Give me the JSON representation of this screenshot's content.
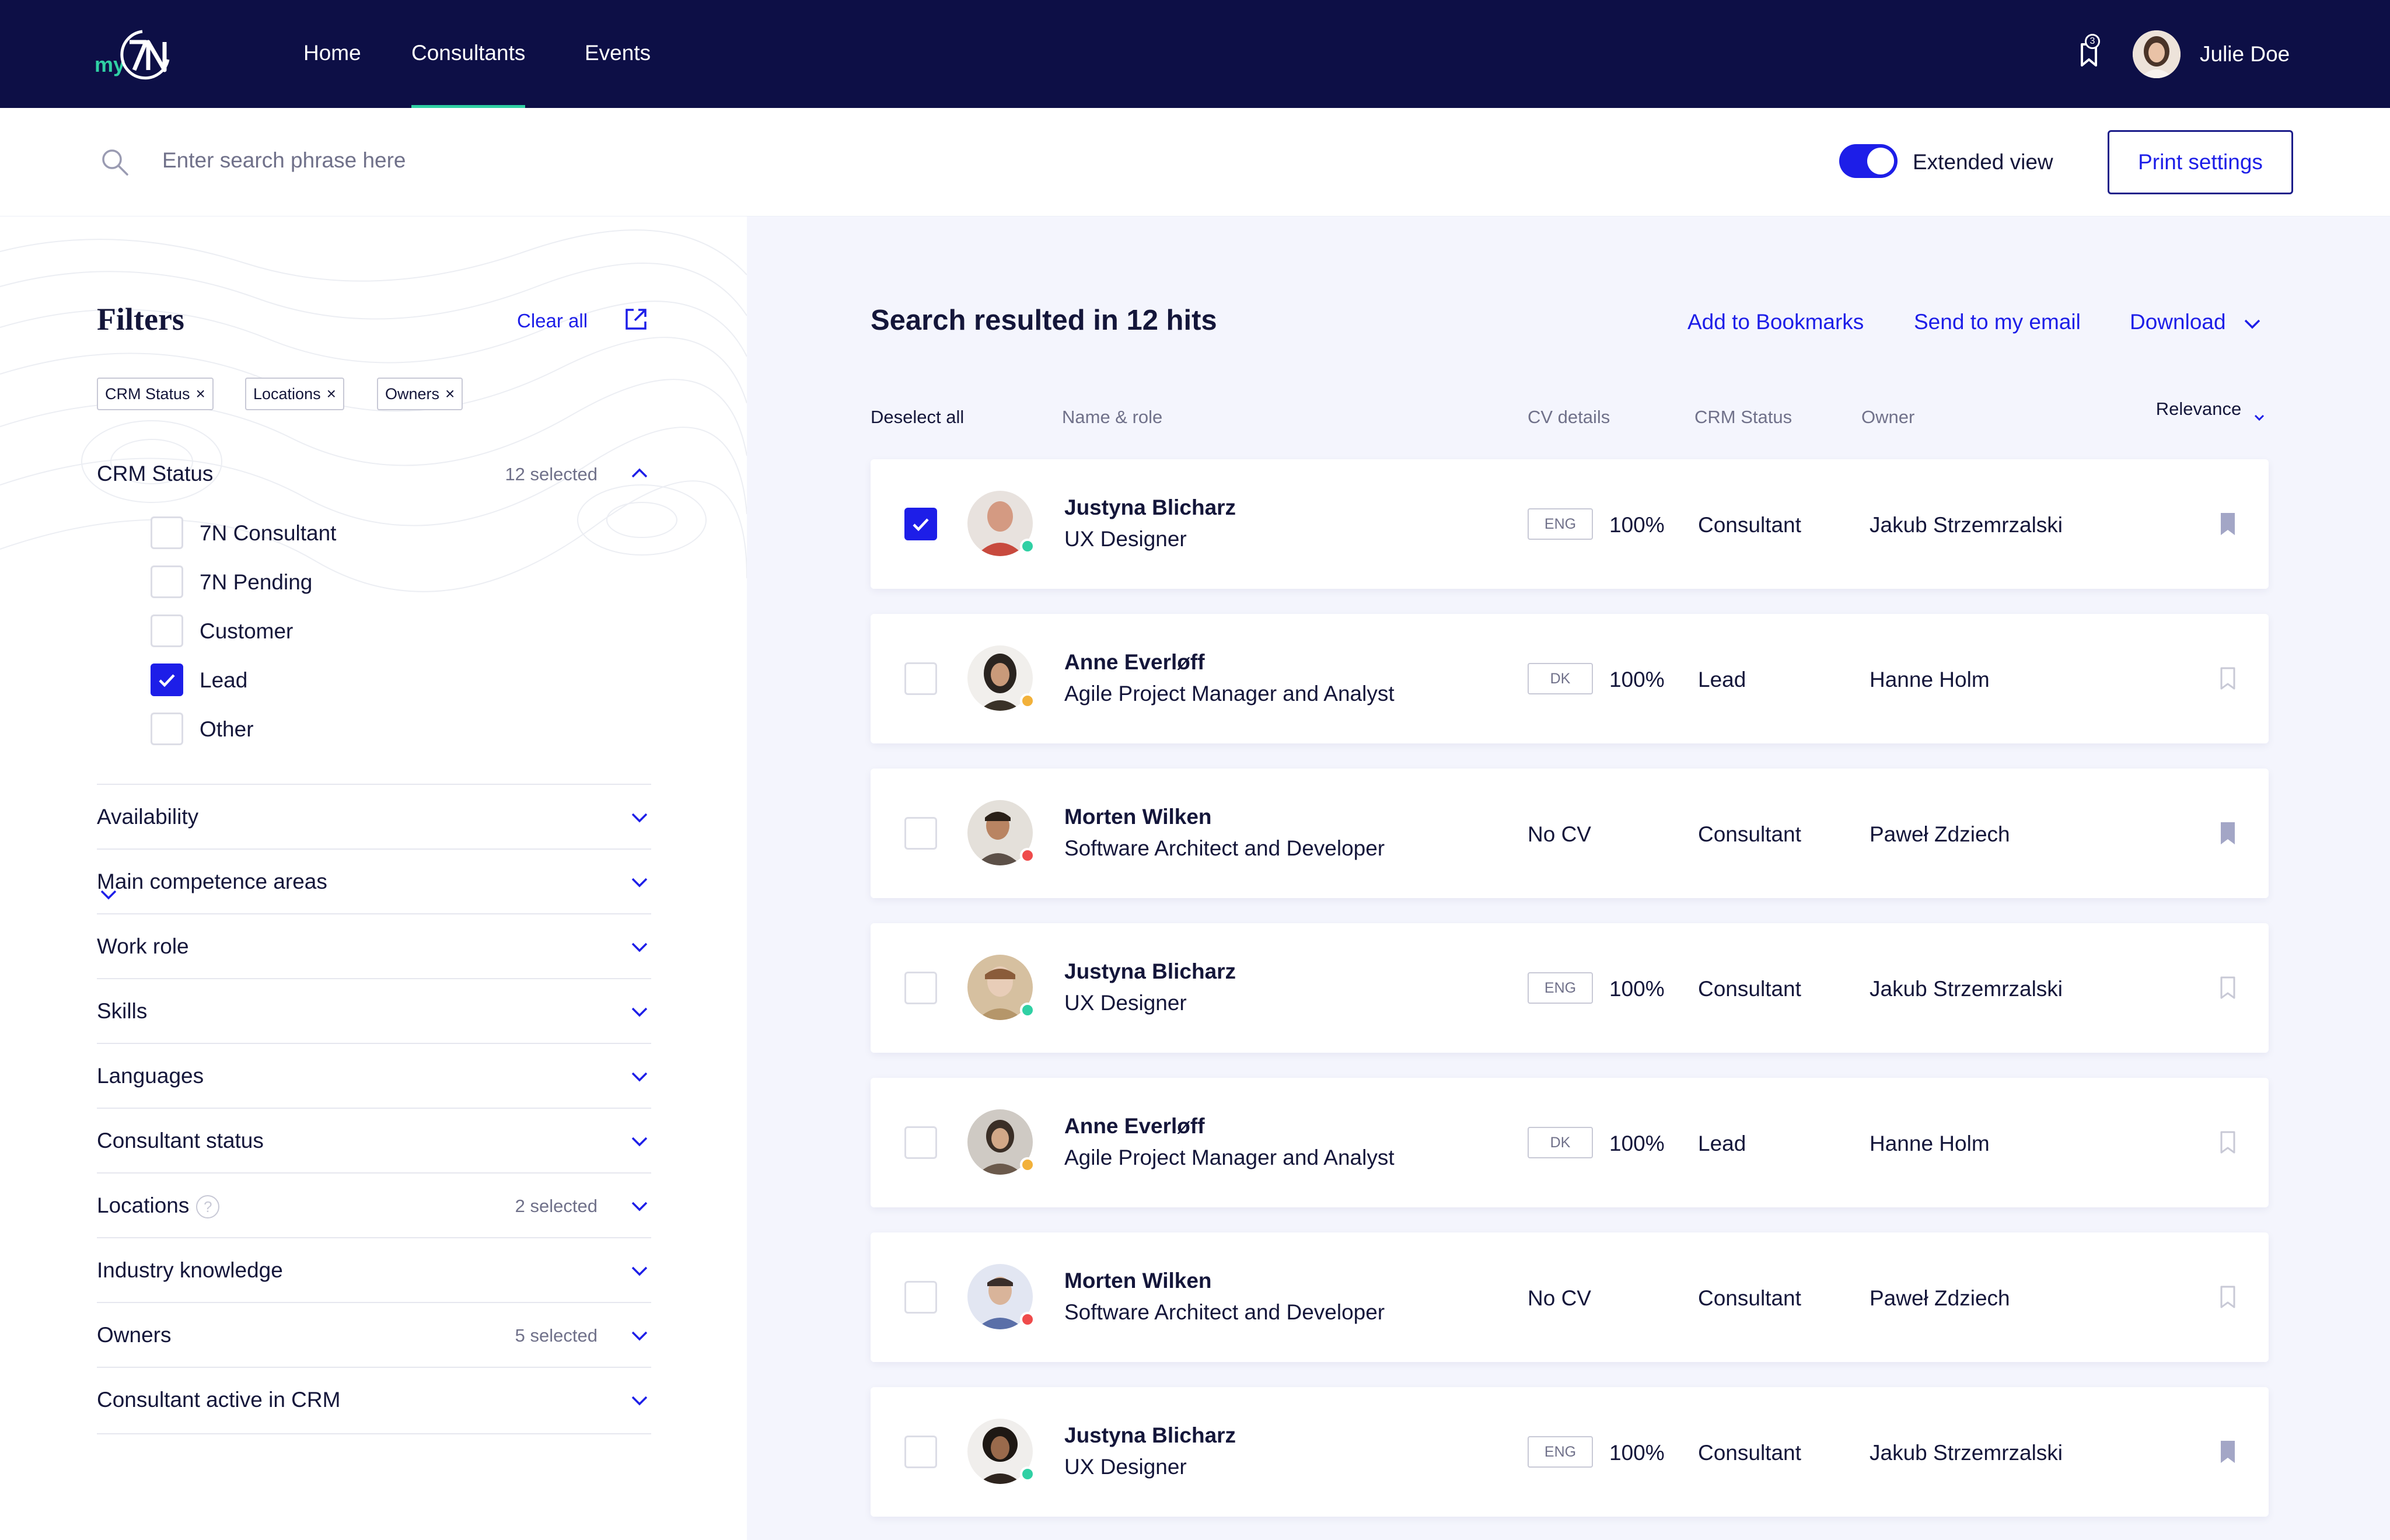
{
  "app": {
    "logo_prefix": "my",
    "logo_text": "7N"
  },
  "nav": {
    "items": [
      {
        "label": "Home",
        "active": false
      },
      {
        "label": "Consultants",
        "active": true
      },
      {
        "label": "Events",
        "active": false
      }
    ]
  },
  "user": {
    "name": "Julie Doe",
    "bookmark_count": "3"
  },
  "search": {
    "placeholder": "Enter search phrase here",
    "value": ""
  },
  "view_toggle": {
    "label": "Extended view",
    "on": true
  },
  "print_button": "Print settings",
  "filters": {
    "title": "Filters",
    "clear_all": "Clear all",
    "chips": [
      "CRM Status",
      "Locations",
      "Owners"
    ],
    "crm_status": {
      "label": "CRM Status",
      "selected": "12 selected",
      "options": [
        {
          "label": "7N Consultant",
          "checked": false
        },
        {
          "label": "7N Pending",
          "checked": false
        },
        {
          "label": "Customer",
          "checked": false
        },
        {
          "label": "Lead",
          "checked": true
        },
        {
          "label": "Other",
          "checked": false
        }
      ]
    },
    "sections": [
      {
        "label": "Availability",
        "selected": ""
      },
      {
        "label": "Main competence areas",
        "selected": ""
      },
      {
        "label": "Work role",
        "selected": ""
      },
      {
        "label": "Skills",
        "selected": ""
      },
      {
        "label": "Languages",
        "selected": ""
      },
      {
        "label": "Consultant status",
        "selected": ""
      },
      {
        "label": "Locations",
        "selected": "2 selected",
        "help": "?"
      },
      {
        "label": "Industry knowledge",
        "selected": ""
      },
      {
        "label": "Owners",
        "selected": "5 selected"
      },
      {
        "label": "Consultant active in CRM",
        "selected": ""
      }
    ]
  },
  "results": {
    "title": "Search resulted in 12 hits",
    "actions": {
      "bookmarks": "Add to Bookmarks",
      "email": "Send to my email",
      "download": "Download"
    },
    "columns": {
      "select": "Deselect all",
      "name": "Name & role",
      "cv": "CV details",
      "crm": "CRM Status",
      "owner": "Owner",
      "relevance": "Relevance"
    },
    "rows": [
      {
        "name": "Justyna Blicharz",
        "role": "UX Designer",
        "lang": "ENG",
        "pct": "100%",
        "crm": "Consultant",
        "owner": "Jakub Strzemrzalski",
        "checked": true,
        "status": "#30d0a4",
        "bookmarked": true,
        "avatar_bg": "#c84a3e"
      },
      {
        "name": "Anne Everløff",
        "role": "Agile Project Manager and Analyst",
        "lang": "DK",
        "pct": "100%",
        "crm": "Lead",
        "owner": "Hanne Holm",
        "checked": false,
        "status": "#f2b13a",
        "bookmarked": false,
        "avatar_bg": "#3a3228"
      },
      {
        "name": "Morten Wilken",
        "role": "Software Architect and Developer",
        "nocv": "No CV",
        "crm": "Consultant",
        "owner": "Paweł Zdziech",
        "checked": false,
        "status": "#ef4b4b",
        "bookmarked": true,
        "avatar_bg": "#8a7a6a"
      },
      {
        "name": "Justyna Blicharz",
        "role": "UX Designer",
        "lang": "ENG",
        "pct": "100%",
        "crm": "Consultant",
        "owner": "Jakub Strzemrzalski",
        "checked": false,
        "status": "#30d0a4",
        "bookmarked": false,
        "avatar_bg": "#b5966a"
      },
      {
        "name": "Anne Everløff",
        "role": "Agile Project Manager and Analyst",
        "lang": "DK",
        "pct": "100%",
        "crm": "Lead",
        "owner": "Hanne Holm",
        "checked": false,
        "status": "#f2b13a",
        "bookmarked": false,
        "avatar_bg": "#6b5a4c"
      },
      {
        "name": "Morten Wilken",
        "role": "Software Architect and Developer",
        "nocv": "No CV",
        "crm": "Consultant",
        "owner": "Paweł Zdziech",
        "checked": false,
        "status": "#ef4b4b",
        "bookmarked": false,
        "avatar_bg": "#5a6fa8"
      },
      {
        "name": "Justyna Blicharz",
        "role": "UX Designer",
        "lang": "ENG",
        "pct": "100%",
        "crm": "Consultant",
        "owner": "Jakub Strzemrzalski",
        "checked": false,
        "status": "#30d0a4",
        "bookmarked": true,
        "avatar_bg": "#2e241e"
      }
    ]
  },
  "colors": {
    "navy": "#0d0f46",
    "accent": "#1d1ee8",
    "teal": "#30d0a4",
    "bookmark_filled": "#a3a6c6",
    "bookmark_outline": "#c8c9d6"
  },
  "icons": {
    "search": "search-icon",
    "bookmark": "bookmark-icon",
    "chevron": "chevron-down-icon",
    "export": "export-icon",
    "check": "check-icon"
  }
}
